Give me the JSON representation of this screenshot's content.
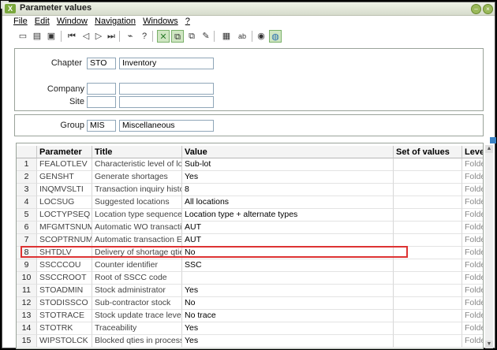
{
  "window": {
    "title": "Parameter values"
  },
  "menu": [
    {
      "label": "File"
    },
    {
      "label": "Edit"
    },
    {
      "label": "Window"
    },
    {
      "label": "Navigation"
    },
    {
      "label": "Windows"
    },
    {
      "label": "?"
    }
  ],
  "form": {
    "chapter_label": "Chapter",
    "chapter_code": "STO",
    "chapter_desc": "Inventory",
    "company_label": "Company",
    "company_code": "",
    "company_desc": "",
    "site_label": "Site",
    "site_code": "",
    "site_desc": "",
    "group_label": "Group",
    "group_code": "MIS",
    "group_desc": "Miscellaneous"
  },
  "grid": {
    "headers": [
      "",
      "Parameter",
      "Title",
      "Value",
      "Set of values",
      "Level"
    ],
    "rows": [
      {
        "n": "1",
        "param": "FEALOTLEV",
        "title": "Characteristic level of lot",
        "value": "Sub-lot",
        "set": "",
        "level": "Folder"
      },
      {
        "n": "2",
        "param": "GENSHT",
        "title": "Generate shortages",
        "value": "Yes",
        "set": "",
        "level": "Folder"
      },
      {
        "n": "3",
        "param": "INQMVSLTI",
        "title": "Transaction inquiry history",
        "value": "8",
        "set": "",
        "level": "Folder"
      },
      {
        "n": "4",
        "param": "LOCSUG",
        "title": "Suggested locations",
        "value": "All locations",
        "set": "",
        "level": "Folder"
      },
      {
        "n": "5",
        "param": "LOCTYPSEQ",
        "title": "Location type sequence",
        "value": "Location type + alternate types",
        "set": "",
        "level": "Folder"
      },
      {
        "n": "6",
        "param": "MFGMTSNUM",
        "title": "Automatic WO transaction",
        "value": "AUT",
        "set": "",
        "level": "Folder"
      },
      {
        "n": "7",
        "param": "SCOPTRNUM",
        "title": "Automatic transaction EO",
        "value": "AUT",
        "set": "",
        "level": "Folder"
      },
      {
        "n": "8",
        "param": "SHTDLV",
        "title": "Delivery of shortage qties",
        "value": "No",
        "set": "",
        "level": "Folder"
      },
      {
        "n": "9",
        "param": "SSCCCOU",
        "title": "Counter identifier",
        "value": "SSC",
        "set": "",
        "level": "Folder"
      },
      {
        "n": "10",
        "param": "SSCCROOT",
        "title": "Root of SSCC code",
        "value": "",
        "set": "",
        "level": "Folder"
      },
      {
        "n": "11",
        "param": "STOADMIN",
        "title": "Stock administrator",
        "value": "Yes",
        "set": "",
        "level": "Folder"
      },
      {
        "n": "12",
        "param": "STODISSCO",
        "title": "Sub-contractor stock",
        "value": "No",
        "set": "",
        "level": "Folder"
      },
      {
        "n": "13",
        "param": "STOTRACE",
        "title": "Stock update trace level",
        "value": "No trace",
        "set": "",
        "level": "Folder"
      },
      {
        "n": "14",
        "param": "STOTRK",
        "title": "Traceability",
        "value": "Yes",
        "set": "",
        "level": "Folder"
      },
      {
        "n": "15",
        "param": "WIPSTOLCK",
        "title": "Blocked qties in process of pu",
        "value": "Yes",
        "set": "",
        "level": "Folder"
      }
    ]
  },
  "toolbar_icons": [
    "new-icon",
    "print-icon",
    "save-icon",
    "first-icon",
    "previous-icon",
    "next-icon",
    "last-icon",
    "attach-icon",
    "help-icon",
    "tool-icon",
    "copy-icon",
    "paste-icon",
    "edit-icon",
    "calc-icon",
    "text-icon",
    "info-icon",
    "globe-icon"
  ]
}
